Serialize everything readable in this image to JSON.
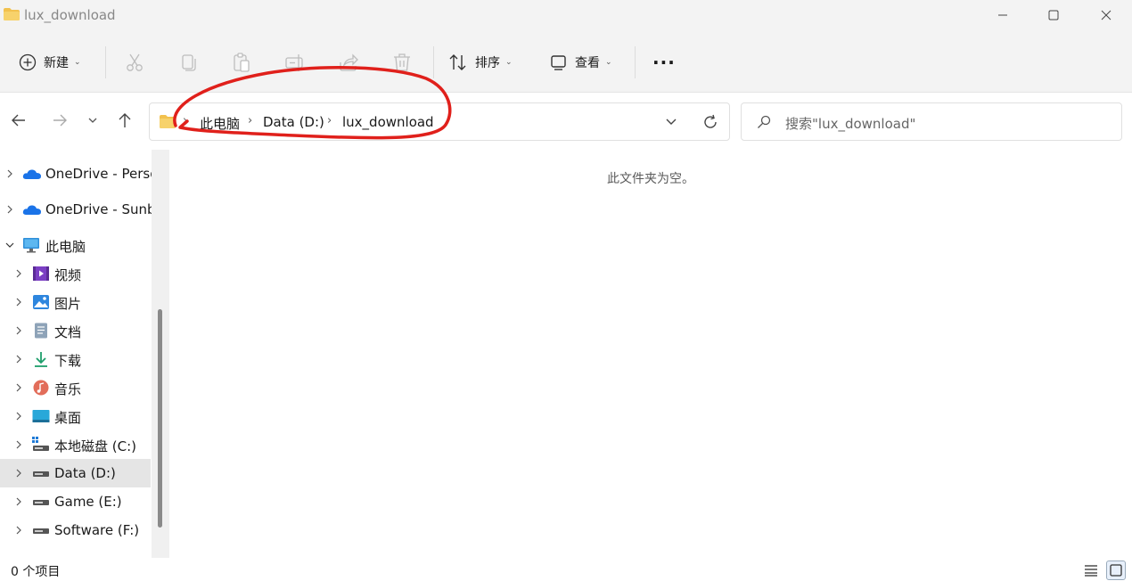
{
  "window": {
    "title": "lux_download",
    "controls": [
      "minimize",
      "maximize",
      "close"
    ]
  },
  "toolbar": {
    "new_label": "新建",
    "sort_label": "排序",
    "view_label": "查看",
    "more_label": "···"
  },
  "nav": {
    "breadcrumb": [
      "此电脑",
      "Data (D:)",
      "lux_download"
    ],
    "search_placeholder": "搜索\"lux_download\""
  },
  "sidebar": {
    "items": [
      {
        "label": "OneDrive - Perso",
        "icon": "onedrive-icon"
      },
      {
        "label": "OneDrive - Sunb",
        "icon": "onedrive-icon"
      },
      {
        "label": "此电脑",
        "icon": "computer-icon"
      },
      {
        "label": "视频",
        "icon": "video-icon"
      },
      {
        "label": "图片",
        "icon": "pictures-icon"
      },
      {
        "label": "文档",
        "icon": "documents-icon"
      },
      {
        "label": "下载",
        "icon": "download-icon"
      },
      {
        "label": "音乐",
        "icon": "music-icon"
      },
      {
        "label": "桌面",
        "icon": "desktop-icon"
      },
      {
        "label": "本地磁盘 (C:)",
        "icon": "drive-icon"
      },
      {
        "label": "Data (D:)",
        "icon": "drive-icon"
      },
      {
        "label": "Game (E:)",
        "icon": "drive-icon"
      },
      {
        "label": "Software (F:)",
        "icon": "drive-icon"
      }
    ],
    "selected": "Data (D:)"
  },
  "content": {
    "empty_message": "此文件夹为空。"
  },
  "status": {
    "item_count": "0 个项目"
  },
  "colors": {
    "annotation": "#e0201b",
    "folder": "#f2c14e",
    "onedrive": "#1a73e8"
  }
}
